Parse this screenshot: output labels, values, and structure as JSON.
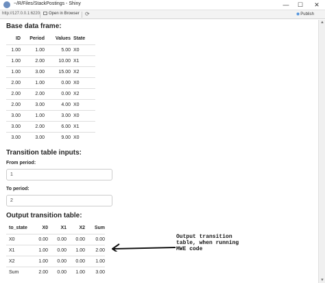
{
  "window": {
    "title": "~/R/Files/StackPostings - Shiny",
    "controls": {
      "minimize": "—",
      "maximize": "☐",
      "close": "✕"
    }
  },
  "addressbar": {
    "url": "http://127.0.0.1:6220",
    "open_in_browser": "Open in Browser",
    "refresh_icon": "refresh-icon",
    "publish": "Publish"
  },
  "base": {
    "heading": "Base data frame:",
    "columns": [
      "ID",
      "Period",
      "Values",
      "State"
    ],
    "rows": [
      [
        "1.00",
        "1.00",
        "5.00",
        "X0"
      ],
      [
        "1.00",
        "2.00",
        "10.00",
        "X1"
      ],
      [
        "1.00",
        "3.00",
        "15.00",
        "X2"
      ],
      [
        "2.00",
        "1.00",
        "0.00",
        "X0"
      ],
      [
        "2.00",
        "2.00",
        "0.00",
        "X2"
      ],
      [
        "2.00",
        "3.00",
        "4.00",
        "X0"
      ],
      [
        "3.00",
        "1.00",
        "3.00",
        "X0"
      ],
      [
        "3.00",
        "2.00",
        "6.00",
        "X1"
      ],
      [
        "3.00",
        "3.00",
        "9.00",
        "X0"
      ]
    ]
  },
  "inputs": {
    "heading": "Transition table inputs:",
    "from_label": "From period:",
    "from_value": "1",
    "to_label": "To period:",
    "to_value": "2"
  },
  "output": {
    "heading": "Output transition table:",
    "columns": [
      "to_state",
      "X0",
      "X1",
      "X2",
      "Sum"
    ],
    "rows": [
      [
        "X0",
        "0.00",
        "0.00",
        "0.00",
        "0.00"
      ],
      [
        "X1",
        "1.00",
        "0.00",
        "1.00",
        "2.00"
      ],
      [
        "X2",
        "1.00",
        "0.00",
        "0.00",
        "1.00"
      ],
      [
        "Sum",
        "2.00",
        "0.00",
        "1.00",
        "3.00"
      ]
    ]
  },
  "annotation": {
    "lines": [
      "Output transition",
      "table, when running",
      "MWE code"
    ]
  }
}
